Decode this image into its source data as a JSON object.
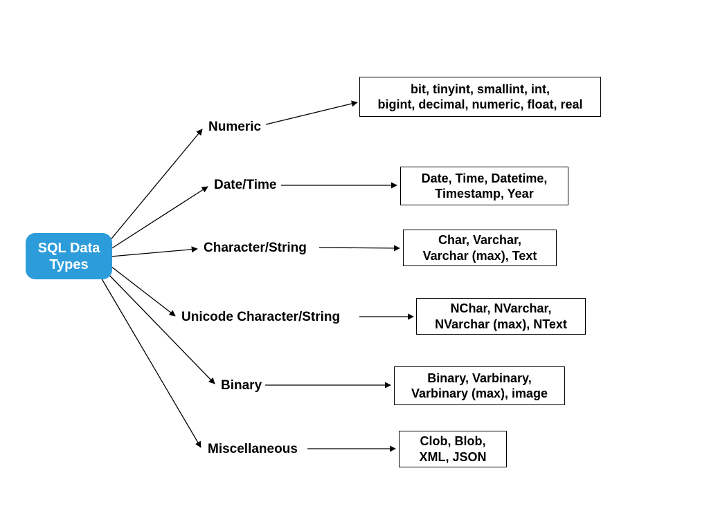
{
  "root": {
    "label": "SQL Data\nTypes"
  },
  "categories": [
    {
      "name": "Numeric",
      "types": "bit, tinyint, smallint, int,\nbigint, decimal, numeric, float, real"
    },
    {
      "name": "Date/Time",
      "types": "Date, Time, Datetime,\nTimestamp, Year"
    },
    {
      "name": "Character/String",
      "types": "Char, Varchar,\nVarchar (max), Text"
    },
    {
      "name": "Unicode Character/String",
      "types": "NChar, NVarchar,\nNVarchar (max), NText"
    },
    {
      "name": "Binary",
      "types": "Binary, Varbinary,\nVarbinary (max), image"
    },
    {
      "name": "Miscellaneous",
      "types": "Clob, Blob,\nXML, JSON"
    }
  ]
}
